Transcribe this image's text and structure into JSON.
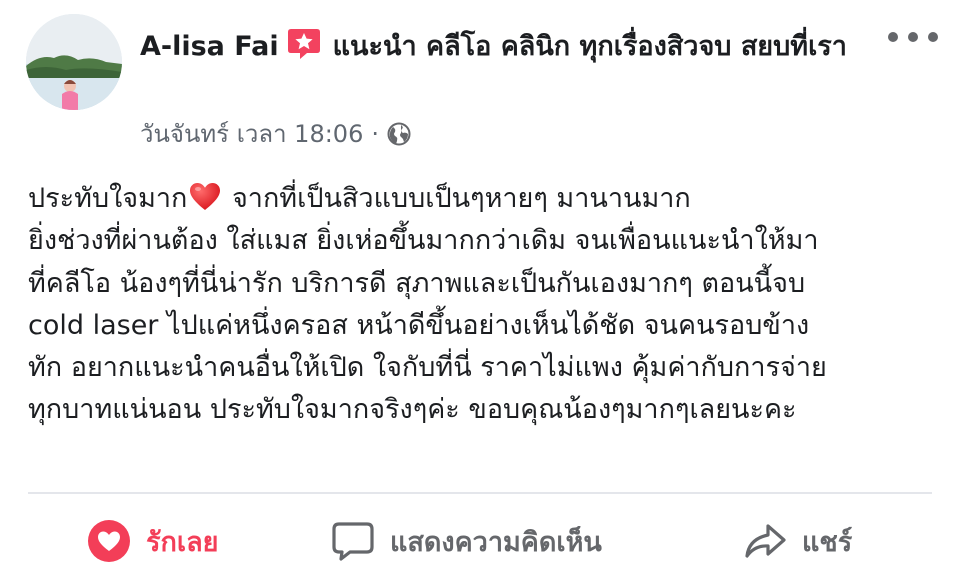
{
  "post": {
    "author": "A-lisa Fai",
    "recommend_text": "แนะนำ คลีโอ คลินิก ทุกเรื่องสิวจบ สยบที่เรา",
    "timestamp": "วันจันทร์ เวลา 18:06",
    "separator": "·",
    "body_lines": {
      "l1_before": "ประทับใจมาก",
      "l1_after": " จากที่เป็นสิวแบบเป็นๆหายๆ มานานมาก",
      "l2": "ยิ่งช่วงที่ผ่านต้อง ใส่แมส ยิ่งเห่อขึ้นมากกว่าเดิม จนเพื่อนแนะนำให้มา",
      "l3": "ที่คลีโอ น้องๆที่นี่น่ารัก บริการดี สุภาพและเป็นกันเองมากๆ ตอนนี้จบ",
      "l4": "cold laser ไปแค่หนึ่งครอส หน้าดีขึ้นอย่างเห็นได้ชัด จนคนรอบข้าง",
      "l5": "ทัก อยากแนะนำคนอื่นให้เปิด ใจกับที่นี่ ราคาไม่แพง คุ้มค่ากับการจ่าย",
      "l6": "ทุกบาทแน่นอน ประทับใจมากจริงๆค่ะ ขอบคุณน้องๆมากๆเลยนะคะ"
    }
  },
  "actions": {
    "like_label": "รักเลย",
    "comment_label": "แสดงความคิดเห็น",
    "share_label": "แชร์"
  },
  "colors": {
    "like_active": "#f33e58",
    "icon_gray": "#65676b",
    "text_primary": "#1c1e21",
    "text_secondary": "#606770",
    "recommend_badge": "#f3425f"
  },
  "icons": {
    "avatar": "profile-photo",
    "recommend": "star-badge-icon",
    "privacy": "globe-icon",
    "more": "more-options-icon",
    "emoji": "red-heart-emoji",
    "like": "love-reaction-icon",
    "comment": "comment-bubble-icon",
    "share": "share-arrow-icon"
  }
}
